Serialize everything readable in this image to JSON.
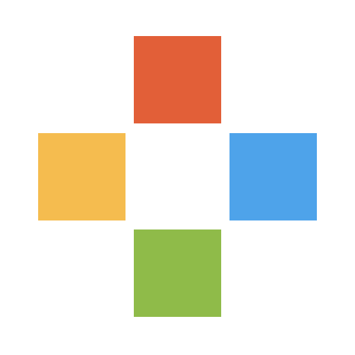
{
  "tiles": {
    "top": {
      "color": "#E25F38"
    },
    "left": {
      "color": "#F5BC4F"
    },
    "right": {
      "color": "#4EA3EA"
    },
    "bottom": {
      "color": "#8FBB49"
    }
  }
}
